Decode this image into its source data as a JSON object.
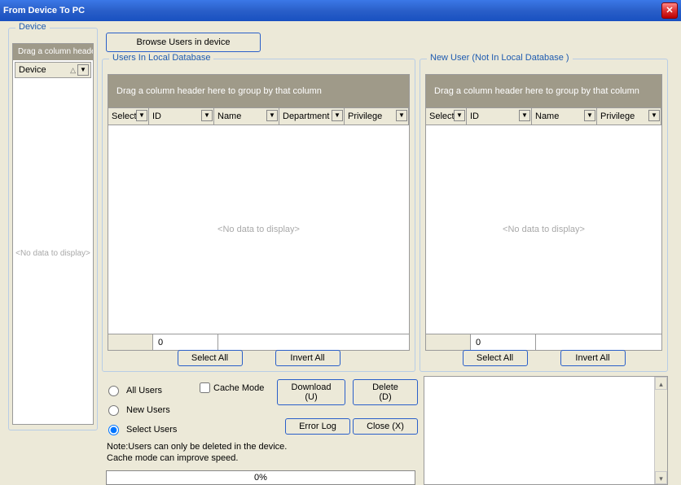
{
  "window": {
    "title": "From Device To PC"
  },
  "device_panel": {
    "title": "Device",
    "drag_hint": "Drag a column header",
    "col": "Device",
    "nodata": "<No data to display>"
  },
  "browse_btn": "Browse Users in device",
  "users_local": {
    "title": "Users In Local Database",
    "drag_hint": "Drag a column header here to group by that column",
    "cols": {
      "select": "Select",
      "id": "ID",
      "name": "Name",
      "dept": "Department",
      "priv": "Privilege"
    },
    "nodata": "<No data to display>",
    "count": "0",
    "select_all": "Select All",
    "invert_all": "Invert All"
  },
  "users_new": {
    "title": "New User (Not In Local Database )",
    "drag_hint": "Drag a column header here to group by that column",
    "cols": {
      "select": "Select",
      "id": "ID",
      "name": "Name",
      "priv": "Privilege"
    },
    "nodata": "<No data to display>",
    "count": "0",
    "select_all": "Select All",
    "invert_all": "Invert All"
  },
  "radios": {
    "all": "All Users",
    "new": "New Users",
    "select": "Select Users"
  },
  "cache": "Cache Mode",
  "buttons": {
    "download": "Download (U)",
    "delete": "Delete (D)",
    "errorlog": "Error Log",
    "close": "Close (X)"
  },
  "note_line1": "Note:Users can only be deleted in the device.",
  "note_line2": "Cache mode can improve speed.",
  "progress": "0%"
}
